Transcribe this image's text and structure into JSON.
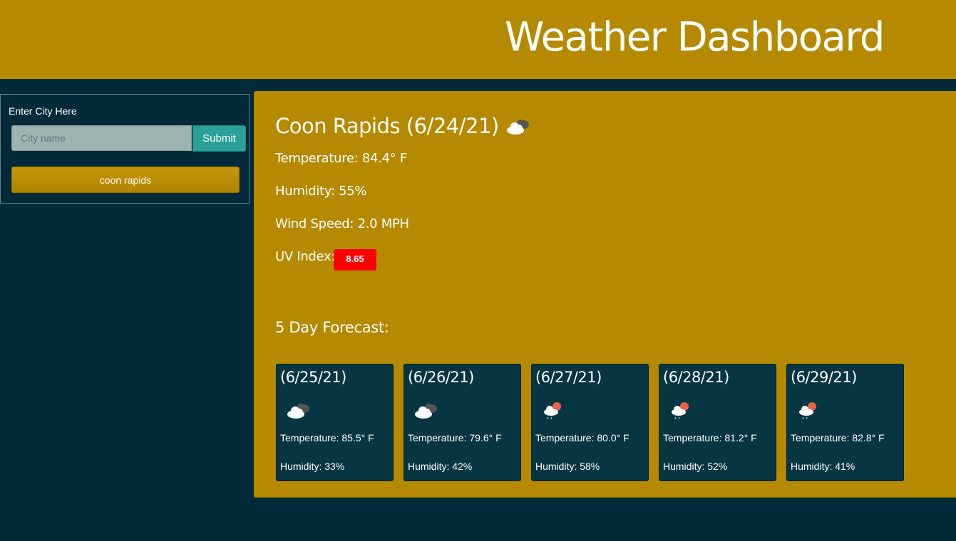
{
  "header": {
    "title": "Weather Dashboard"
  },
  "search": {
    "label": "Enter City Here",
    "placeholder": "City name",
    "submit_label": "Submit",
    "history": [
      "coon rapids"
    ]
  },
  "current": {
    "title": "Coon Rapids (6/24/21)",
    "icon": "cloudy-icon",
    "temperature": "Temperature: 84.4° F",
    "humidity": "Humidity: 55%",
    "wind": "Wind Speed: 2.0 MPH",
    "uv_label": "UV Index:",
    "uv_value": "8.65",
    "uv_color": "#ff0000"
  },
  "forecast": {
    "title": "5 Day Forecast:",
    "days": [
      {
        "date": "(6/25/21)",
        "icon": "cloudy-icon",
        "temp": "Temperature: 85.5° F",
        "humidity": "Humidity: 33%"
      },
      {
        "date": "(6/26/21)",
        "icon": "cloudy-icon",
        "temp": "Temperature: 79.6° F",
        "humidity": "Humidity: 42%"
      },
      {
        "date": "(6/27/21)",
        "icon": "sun-rain-icon",
        "temp": "Temperature: 80.0° F",
        "humidity": "Humidity: 58%"
      },
      {
        "date": "(6/28/21)",
        "icon": "sun-rain-icon",
        "temp": "Temperature: 81.2° F",
        "humidity": "Humidity: 52%"
      },
      {
        "date": "(6/29/21)",
        "icon": "sun-rain-icon",
        "temp": "Temperature: 82.8° F",
        "humidity": "Humidity: 41%"
      }
    ]
  },
  "colors": {
    "background": "#022a38",
    "accent": "#b58900",
    "card": "#073642",
    "submit": "#2aa198"
  }
}
